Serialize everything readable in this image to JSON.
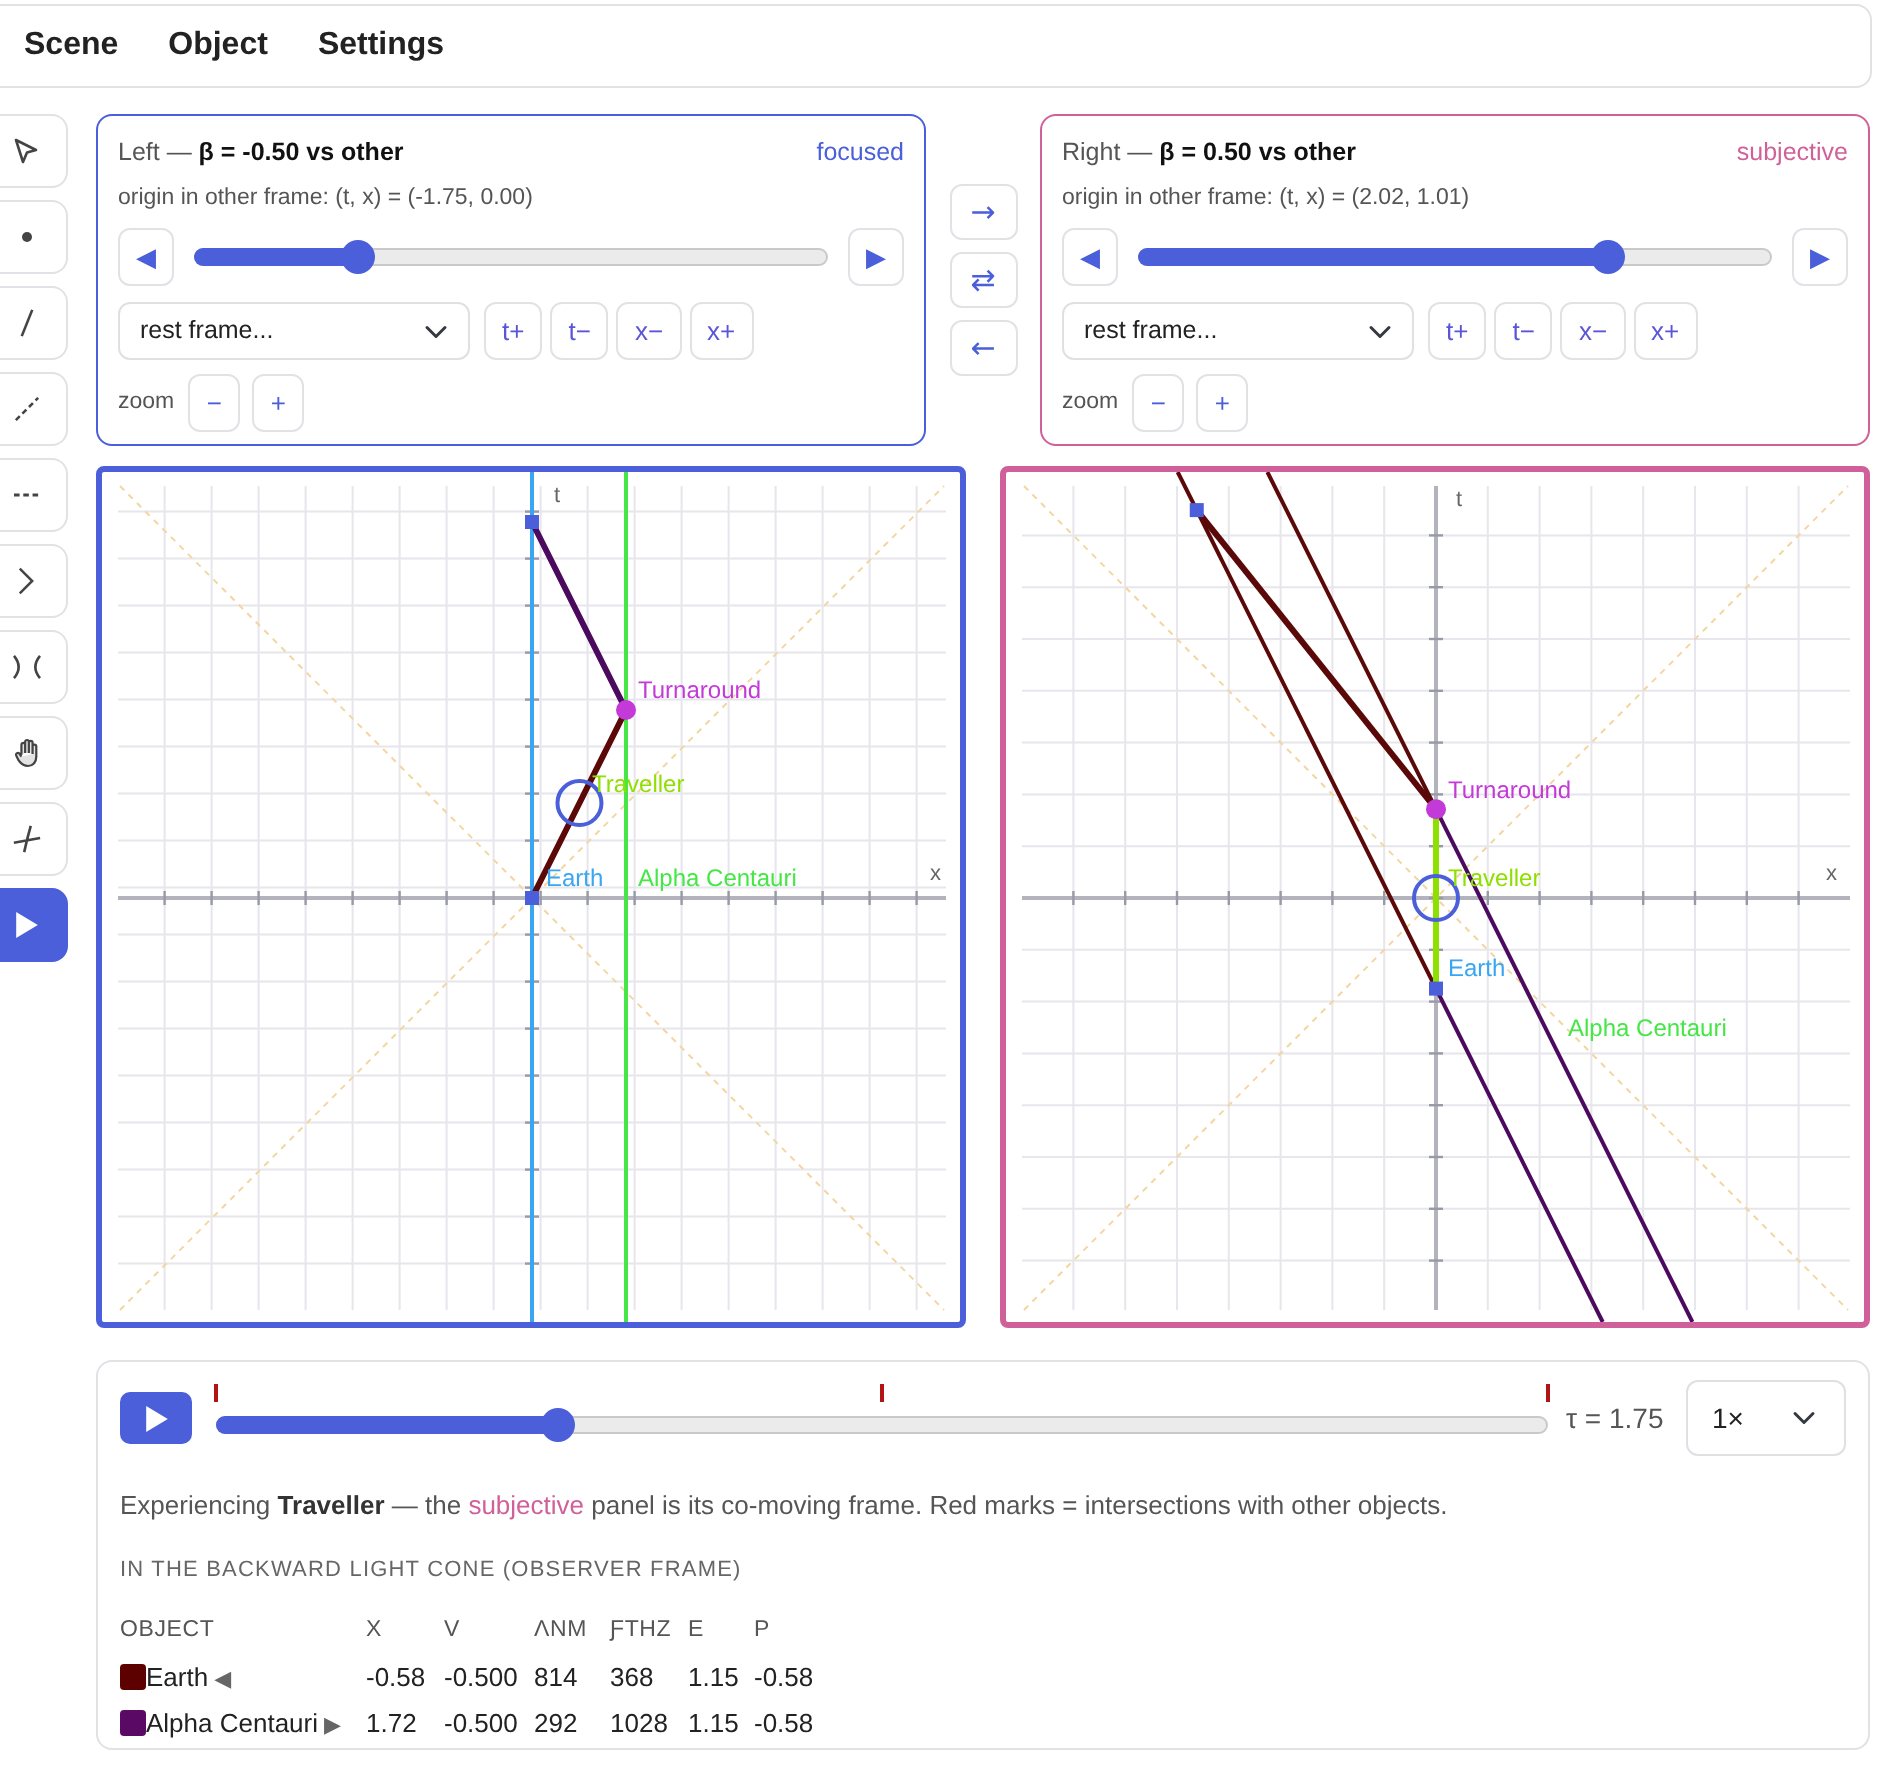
{
  "menu": [
    {
      "label": "Scene"
    },
    {
      "label": "Object"
    },
    {
      "label": "Settings"
    }
  ],
  "tools": [
    {
      "kind": "select",
      "selected": false
    },
    {
      "kind": "point",
      "selected": false
    },
    {
      "kind": "line",
      "selected": false
    },
    {
      "kind": "dashed-line",
      "selected": false
    },
    {
      "kind": "dashes",
      "selected": false
    },
    {
      "kind": "chevron",
      "selected": false
    },
    {
      "kind": "arcs",
      "selected": false
    },
    {
      "kind": "hand",
      "selected": false
    },
    {
      "kind": "cross",
      "selected": false
    },
    {
      "kind": "play",
      "selected": true
    }
  ],
  "panels": [
    {
      "title": "Left — **β = -0.50 vs other**",
      "status": "focused",
      "color": "#4a5fd9",
      "origin": "origin in other frame: (t, x) = (-1.75, 0.00)",
      "step_back": "◀",
      "step_forward": "▶",
      "level": 0.26,
      "frame_select": "rest frame...",
      "shift_buttons": [
        "t+",
        "t−",
        "x−",
        "x+"
      ],
      "zoom_label": "zoom",
      "zoom_buttons": [
        "−",
        "+"
      ]
    },
    {
      "title": "Right — **β = 0.50 vs other**",
      "status": "subjective",
      "color": "#d0609a",
      "origin": "origin in other frame: (t, x) = (2.02, 1.01)",
      "step_back": "◀",
      "step_forward": "▶",
      "level": 0.74,
      "frame_select": "rest frame...",
      "shift_buttons": [
        "t+",
        "t−",
        "x−",
        "x+"
      ],
      "zoom_label": "zoom",
      "zoom_buttons": [
        "−",
        "+"
      ]
    }
  ],
  "transfer_buttons": [
    "→",
    "⇄",
    "←"
  ],
  "diagrams": [
    {
      "t_label": "t",
      "x_label": "x",
      "labels": [
        {
          "text": "Turnaround",
          "color": "#c43ad8"
        },
        {
          "text": "Traveller",
          "color": "#8ee000"
        },
        {
          "text": "Earth",
          "color": "#3aa6f2"
        },
        {
          "text": "Alpha Centauri",
          "color": "#45e645"
        }
      ]
    },
    {
      "t_label": "t",
      "x_label": "x",
      "labels": [
        {
          "text": "Turnaround",
          "color": "#c43ad8"
        },
        {
          "text": "Traveller",
          "color": "#8ee000"
        },
        {
          "text": "Earth",
          "color": "#3aa6f2"
        },
        {
          "text": "Alpha Centauri",
          "color": "#45e645"
        }
      ]
    }
  ],
  "playback": {
    "level": 0.257,
    "reading": "τ = 1.75",
    "speed": "1×"
  },
  "caption": {
    "before": "Experiencing **Traveller** — the ",
    "highlight": "subjective",
    "after": " panel is its co-moving frame. Red marks = intersections with other objects."
  },
  "light_cone": {
    "heading": "IN THE BACKWARD LIGHT CONE (OBSERVER FRAME)",
    "object_column": "OBJECT",
    "columns": [
      "X",
      "V",
      "ΛNM",
      "ƑTHZ",
      "E",
      "P"
    ],
    "rows": [
      {
        "name": "Earth",
        "direction": "◀",
        "color": "#5c0000",
        "cells": [
          "-0.58",
          "-0.500",
          "814",
          "368",
          "1.15",
          "-0.58"
        ]
      },
      {
        "name": "Alpha Centauri",
        "direction": "▶",
        "color": "#5a0a64",
        "cells": [
          "1.72",
          "-0.500",
          "292",
          "1028",
          "1.15",
          "-0.58"
        ]
      }
    ]
  }
}
